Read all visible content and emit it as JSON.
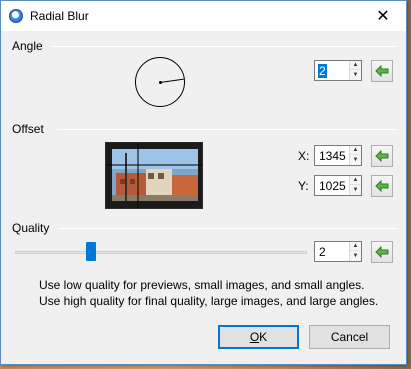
{
  "window": {
    "title": "Radial Blur",
    "close_label": "✕"
  },
  "angle": {
    "label": "Angle",
    "value": "2",
    "dial_angle_deg": 2
  },
  "offset": {
    "label": "Offset",
    "x_label": "X:",
    "x_value": "1345",
    "y_label": "Y:",
    "y_value": "1025"
  },
  "quality": {
    "label": "Quality",
    "value": "2",
    "slider_level_fraction": 0.25,
    "hint_line1": "Use low quality for previews, small images, and small angles.",
    "hint_line2": "Use high quality for final quality, large images, and large angles."
  },
  "buttons": {
    "ok_mnemonic": "O",
    "ok_rest": "K",
    "cancel": "Cancel"
  },
  "colors": {
    "accent": "#0078d7",
    "reset_arrow": "#3f9b2f"
  }
}
